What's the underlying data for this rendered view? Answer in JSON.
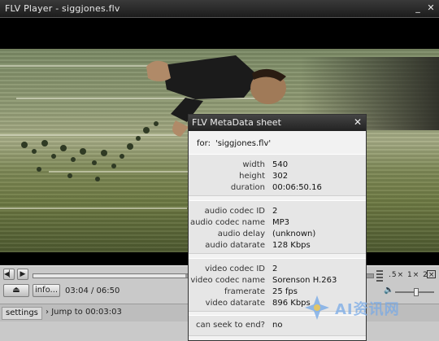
{
  "window": {
    "title": "FLV Player - siggjones.flv",
    "minimize_icon": "minimize-icon",
    "close_icon": "close-icon"
  },
  "player": {
    "time_current": "03:04",
    "time_total": "06:50",
    "time_label": "03:04 / 06:50",
    "progress_fraction": 0.448,
    "volume_fraction": 0.55,
    "buttons": {
      "prev_icon": "skip-back-icon",
      "play_icon": "play-icon",
      "eject_icon": "eject-icon",
      "info": "info..."
    },
    "zoom_label": ".5× 1× 2×",
    "fullscreen_icon": "fullscreen-icon",
    "volume_icon": "speaker-icon"
  },
  "statusbar": {
    "settings": "settings",
    "jump": "Jump to 00:03:03"
  },
  "metadata": {
    "title": "FLV MetaData sheet",
    "for_label": "for:",
    "file": "'siggjones.flv'",
    "groups": [
      [
        {
          "k": "width",
          "v": "540"
        },
        {
          "k": "height",
          "v": "302"
        },
        {
          "k": "duration",
          "v": "00:06:50.16"
        }
      ],
      [
        {
          "k": "audio codec ID",
          "v": "2"
        },
        {
          "k": "audio codec name",
          "v": "MP3"
        },
        {
          "k": "audio delay",
          "v": "(unknown)"
        },
        {
          "k": "audio datarate",
          "v": "128 Kbps"
        }
      ],
      [
        {
          "k": "video codec ID",
          "v": "2"
        },
        {
          "k": "video codec name",
          "v": "Sorenson H.263"
        },
        {
          "k": "framerate",
          "v": "25 fps"
        },
        {
          "k": "video datarate",
          "v": "896 Kbps"
        }
      ],
      [
        {
          "k": "can seek to end?",
          "v": "no"
        }
      ]
    ]
  },
  "watermark": {
    "text": "AI资讯网"
  }
}
